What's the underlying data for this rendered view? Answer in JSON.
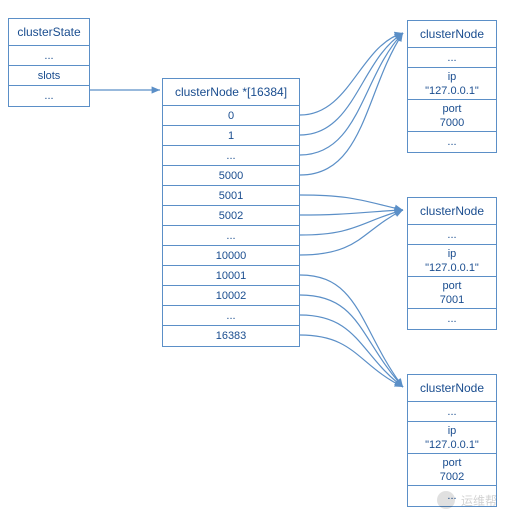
{
  "clusterState": {
    "title": "clusterState",
    "rows": [
      "...",
      "slots",
      "..."
    ]
  },
  "slotArray": {
    "title": "clusterNode *[16384]",
    "rows": [
      "0",
      "1",
      "...",
      "5000",
      "5001",
      "5002",
      "...",
      "10000",
      "10001",
      "10002",
      "...",
      "16383"
    ]
  },
  "nodes": [
    {
      "title": "clusterNode",
      "rows": [
        {
          "type": "single",
          "text": "..."
        },
        {
          "type": "double",
          "line1": "ip",
          "line2": "\"127.0.0.1\""
        },
        {
          "type": "double",
          "line1": "port",
          "line2": "7000"
        },
        {
          "type": "single",
          "text": "..."
        }
      ]
    },
    {
      "title": "clusterNode",
      "rows": [
        {
          "type": "single",
          "text": "..."
        },
        {
          "type": "double",
          "line1": "ip",
          "line2": "\"127.0.0.1\""
        },
        {
          "type": "double",
          "line1": "port",
          "line2": "7001"
        },
        {
          "type": "single",
          "text": "..."
        }
      ]
    },
    {
      "title": "clusterNode",
      "rows": [
        {
          "type": "single",
          "text": "..."
        },
        {
          "type": "double",
          "line1": "ip",
          "line2": "\"127.0.0.1\""
        },
        {
          "type": "double",
          "line1": "port",
          "line2": "7002"
        },
        {
          "type": "single",
          "text": "..."
        }
      ]
    }
  ],
  "watermark": "运维帮",
  "colors": {
    "stroke": "#5b8fc7",
    "text": "#1a4d8f"
  }
}
